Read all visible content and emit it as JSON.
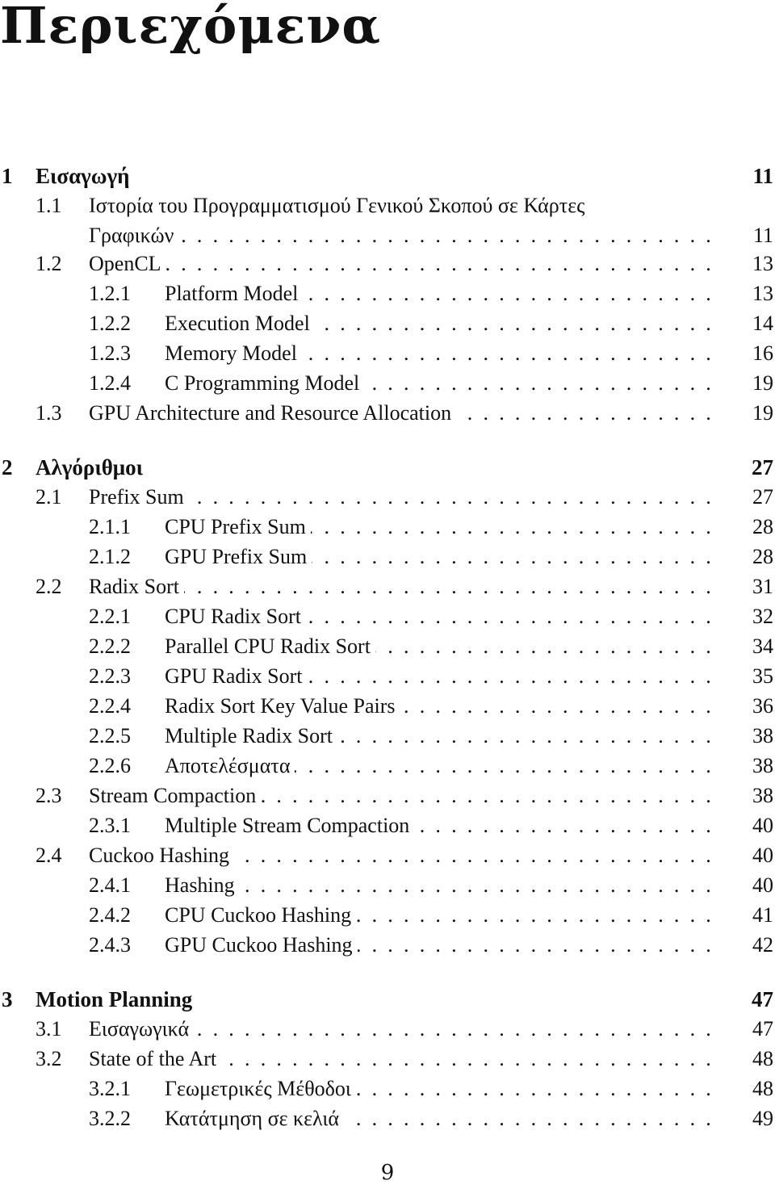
{
  "page_title": "Περιεχόμενα",
  "toc": [
    {
      "level": "chapter",
      "num": "1",
      "title": "Εισαγωγή",
      "page": "11",
      "leader": false
    },
    {
      "level": "section",
      "num": "1.1",
      "title": "Ιστορία του Προγραμματισμού Γενικού Σκοπού σε Κάρτες",
      "page": "",
      "leader": false
    },
    {
      "level": "continuation",
      "num": "",
      "title": "Γραφικών",
      "page": "11",
      "leader": true
    },
    {
      "level": "section",
      "num": "1.2",
      "title": "OpenCL",
      "page": "13",
      "leader": true
    },
    {
      "level": "subsection",
      "num": "1.2.1",
      "title": "Platform Model",
      "page": "13",
      "leader": true
    },
    {
      "level": "subsection",
      "num": "1.2.2",
      "title": "Execution Model",
      "page": "14",
      "leader": true
    },
    {
      "level": "subsection",
      "num": "1.2.3",
      "title": "Memory Model",
      "page": "16",
      "leader": true
    },
    {
      "level": "subsection",
      "num": "1.2.4",
      "title": "C Programming Model",
      "page": "19",
      "leader": true
    },
    {
      "level": "section",
      "num": "1.3",
      "title": "GPU Architecture and Resource Allocation",
      "page": "19",
      "leader": true
    },
    {
      "level": "chapter",
      "num": "2",
      "title": "Αλγόριθμοι",
      "page": "27",
      "leader": false
    },
    {
      "level": "section",
      "num": "2.1",
      "title": "Prefix Sum",
      "page": "27",
      "leader": true
    },
    {
      "level": "subsection",
      "num": "2.1.1",
      "title": "CPU Prefix Sum",
      "page": "28",
      "leader": true
    },
    {
      "level": "subsection",
      "num": "2.1.2",
      "title": "GPU Prefix Sum",
      "page": "28",
      "leader": true
    },
    {
      "level": "section",
      "num": "2.2",
      "title": "Radix Sort",
      "page": "31",
      "leader": true
    },
    {
      "level": "subsection",
      "num": "2.2.1",
      "title": "CPU Radix Sort",
      "page": "32",
      "leader": true
    },
    {
      "level": "subsection",
      "num": "2.2.2",
      "title": "Parallel CPU Radix Sort",
      "page": "34",
      "leader": true
    },
    {
      "level": "subsection",
      "num": "2.2.3",
      "title": "GPU Radix Sort",
      "page": "35",
      "leader": true
    },
    {
      "level": "subsection",
      "num": "2.2.4",
      "title": "Radix Sort Key Value Pairs",
      "page": "36",
      "leader": true
    },
    {
      "level": "subsection",
      "num": "2.2.5",
      "title": "Multiple Radix Sort",
      "page": "38",
      "leader": true
    },
    {
      "level": "subsection",
      "num": "2.2.6",
      "title": "Αποτελέσματα",
      "page": "38",
      "leader": true
    },
    {
      "level": "section",
      "num": "2.3",
      "title": "Stream Compaction",
      "page": "38",
      "leader": true
    },
    {
      "level": "subsection",
      "num": "2.3.1",
      "title": "Multiple Stream Compaction",
      "page": "40",
      "leader": true
    },
    {
      "level": "section",
      "num": "2.4",
      "title": "Cuckoo Hashing",
      "page": "40",
      "leader": true
    },
    {
      "level": "subsection",
      "num": "2.4.1",
      "title": "Hashing",
      "page": "40",
      "leader": true
    },
    {
      "level": "subsection",
      "num": "2.4.2",
      "title": "CPU Cuckoo Hashing",
      "page": "41",
      "leader": true
    },
    {
      "level": "subsection",
      "num": "2.4.3",
      "title": "GPU Cuckoo Hashing",
      "page": "42",
      "leader": true
    },
    {
      "level": "chapter",
      "num": "3",
      "title": "Motion Planning",
      "page": "47",
      "leader": false
    },
    {
      "level": "section",
      "num": "3.1",
      "title": "Εισαγωγικά",
      "page": "47",
      "leader": true
    },
    {
      "level": "section",
      "num": "3.2",
      "title": "State of the Art",
      "page": "48",
      "leader": true
    },
    {
      "level": "subsection",
      "num": "3.2.1",
      "title": "Γεωμετρικές Μέθοδοι",
      "page": "48",
      "leader": true
    },
    {
      "level": "subsection",
      "num": "3.2.2",
      "title": "Κατάτμηση σε κελιά",
      "page": "49",
      "leader": true
    }
  ],
  "page_number": "9"
}
